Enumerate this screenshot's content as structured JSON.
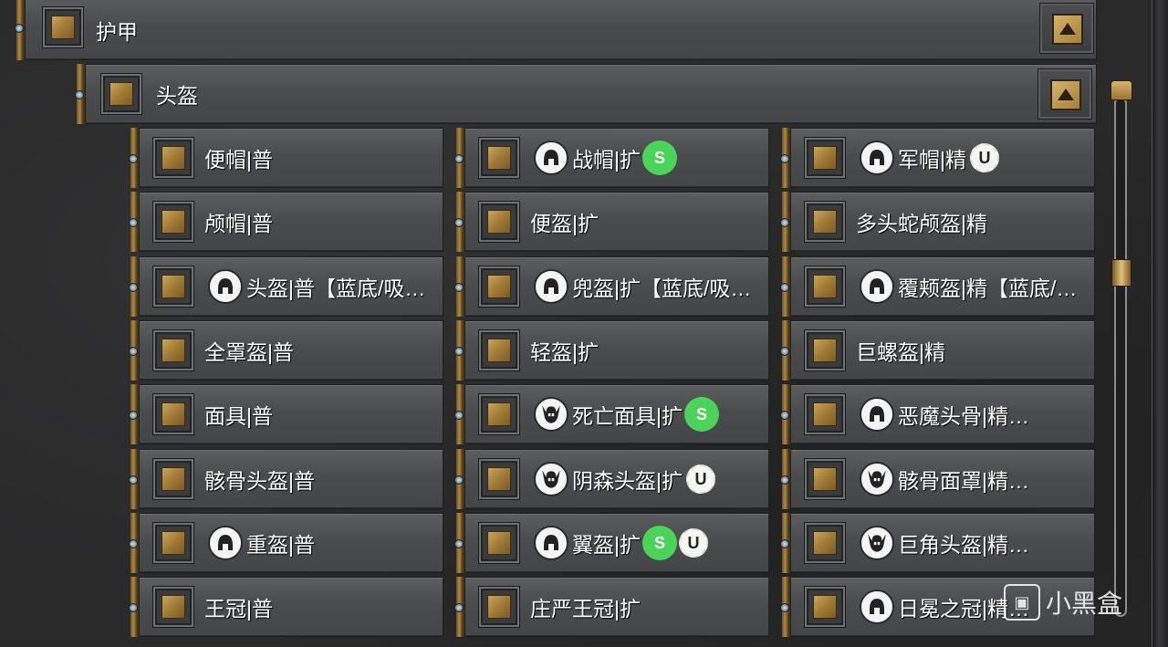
{
  "category": {
    "label": "护甲"
  },
  "subcategory": {
    "label": "头盔"
  },
  "columns": [
    [
      {
        "name": "便帽|普",
        "icon": "",
        "badges": []
      },
      {
        "name": "颅帽|普",
        "icon": "",
        "badges": []
      },
      {
        "name": "头盔|普【蓝底/吸…",
        "icon": "helmet-icon",
        "badges": []
      },
      {
        "name": "全罩盔|普",
        "icon": "",
        "badges": []
      },
      {
        "name": "面具|普",
        "icon": "",
        "badges": []
      },
      {
        "name": "骸骨头盔|普",
        "icon": "",
        "badges": []
      },
      {
        "name": "重盔|普",
        "icon": "helmet-icon",
        "badges": []
      },
      {
        "name": "王冠|普",
        "icon": "",
        "badges": []
      }
    ],
    [
      {
        "name": "战帽|扩",
        "icon": "helmet-icon",
        "badges": [
          "S"
        ]
      },
      {
        "name": "便盔|扩",
        "icon": "",
        "badges": []
      },
      {
        "name": "兜盔|扩【蓝底/吸…",
        "icon": "helmet-icon",
        "badges": []
      },
      {
        "name": "轻盔|扩",
        "icon": "",
        "badges": []
      },
      {
        "name": "死亡面具|扩",
        "icon": "horned-mask-icon",
        "badges": [
          "S"
        ]
      },
      {
        "name": "阴森头盔|扩",
        "icon": "horned-mask-icon",
        "badges": [
          "U"
        ]
      },
      {
        "name": "翼盔|扩",
        "icon": "helmet-icon",
        "badges": [
          "S",
          "U"
        ]
      },
      {
        "name": "庄严王冠|扩",
        "icon": "",
        "badges": []
      }
    ],
    [
      {
        "name": "军帽|精",
        "icon": "helmet-icon",
        "badges": [
          "U"
        ]
      },
      {
        "name": "多头蛇颅盔|精",
        "icon": "",
        "badges": []
      },
      {
        "name": "覆颊盔|精【蓝底/…",
        "icon": "helmet-icon",
        "badges": []
      },
      {
        "name": "巨螺盔|精",
        "icon": "",
        "badges": []
      },
      {
        "name": "恶魔头骨|精…",
        "icon": "helmet-icon",
        "badges": []
      },
      {
        "name": "骸骨面罩|精…",
        "icon": "horned-mask-icon",
        "badges": []
      },
      {
        "name": "巨角头盔|精…",
        "icon": "horned-mask-icon",
        "badges": []
      },
      {
        "name": "日冕之冠|精…",
        "icon": "helmet-icon",
        "badges": []
      }
    ]
  ],
  "badge_colors": {
    "S": "#4cd35a",
    "U": "#f6f6f0"
  },
  "watermark": {
    "text": "小黑盒"
  }
}
